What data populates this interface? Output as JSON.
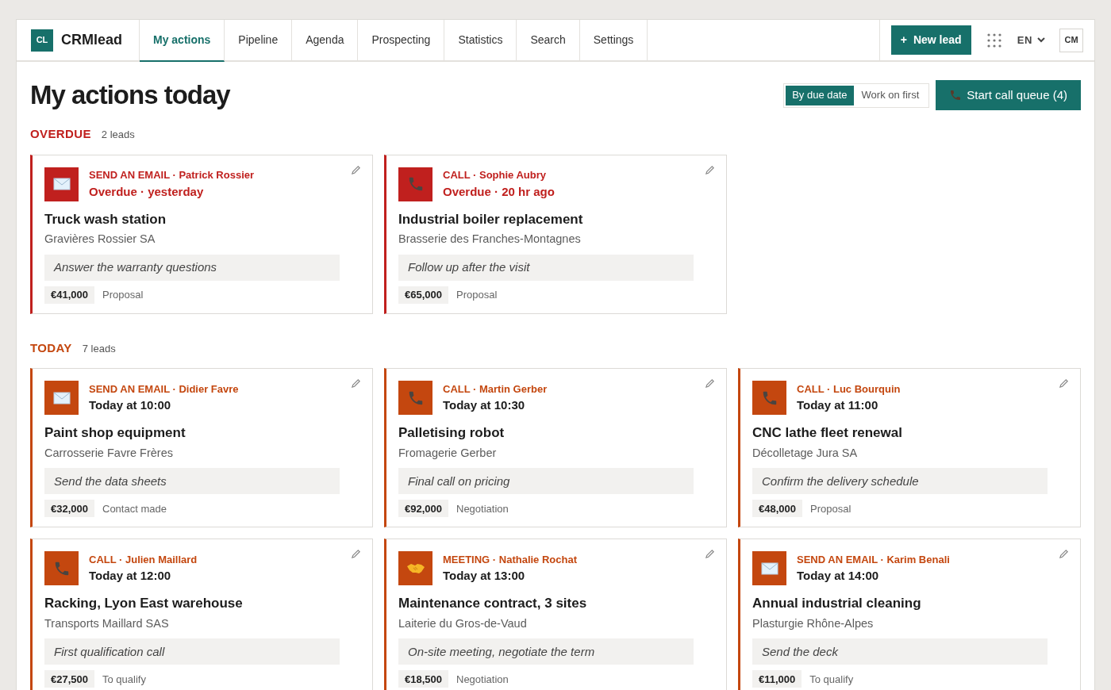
{
  "brand": {
    "badge": "CL",
    "name": "CRMlead"
  },
  "tabs": [
    {
      "label": "My actions",
      "selected": true
    },
    {
      "label": "Pipeline",
      "selected": false
    },
    {
      "label": "Agenda",
      "selected": false
    },
    {
      "label": "Prospecting",
      "selected": false
    },
    {
      "label": "Statistics",
      "selected": false
    },
    {
      "label": "Search",
      "selected": false
    },
    {
      "label": "Settings",
      "selected": false
    }
  ],
  "new_lead_button": {
    "icon": "+",
    "label": "New lead"
  },
  "language": "EN",
  "user_badge": "CM",
  "page_title": "My actions today",
  "sort_toggle": [
    {
      "label": "By due date",
      "selected": true
    },
    {
      "label": "Work on first",
      "selected": false
    }
  ],
  "call_queue_button": "Start call queue (4)",
  "sections": [
    {
      "kind": "overdue",
      "title": "OVERDUE",
      "count": "2 leads",
      "cards": [
        {
          "kind": "email",
          "action": "SEND AN EMAIL · Patrick Rossier",
          "due": "Overdue · yesterday",
          "title": "Truck wash station",
          "company": "Gravières Rossier SA",
          "note": "Answer the warranty questions",
          "amount": "€41,000",
          "stage": "Proposal"
        },
        {
          "kind": "call",
          "action": "CALL · Sophie Aubry",
          "due": "Overdue · 20 hr ago",
          "title": "Industrial boiler replacement",
          "company": "Brasserie des Franches-Montagnes",
          "note": "Follow up after the visit",
          "amount": "€65,000",
          "stage": "Proposal"
        }
      ]
    },
    {
      "kind": "today",
      "title": "TODAY",
      "count": "7 leads",
      "cards": [
        {
          "kind": "email",
          "action": "SEND AN EMAIL · Didier Favre",
          "due": "Today at 10:00",
          "title": "Paint shop equipment",
          "company": "Carrosserie Favre Frères",
          "note": "Send the data sheets",
          "amount": "€32,000",
          "stage": "Contact made"
        },
        {
          "kind": "call",
          "action": "CALL · Martin Gerber",
          "due": "Today at 10:30",
          "title": "Palletising robot",
          "company": "Fromagerie Gerber",
          "note": "Final call on pricing",
          "amount": "€92,000",
          "stage": "Negotiation"
        },
        {
          "kind": "call",
          "action": "CALL · Luc Bourquin",
          "due": "Today at 11:00",
          "title": "CNC lathe fleet renewal",
          "company": "Décolletage Jura SA",
          "note": "Confirm the delivery schedule",
          "amount": "€48,000",
          "stage": "Proposal"
        },
        {
          "kind": "call",
          "action": "CALL · Julien Maillard",
          "due": "Today at 12:00",
          "title": "Racking, Lyon East warehouse",
          "company": "Transports Maillard SAS",
          "note": "First qualification call",
          "amount": "€27,500",
          "stage": "To qualify"
        },
        {
          "kind": "meeting",
          "action": "MEETING · Nathalie Rochat",
          "due": "Today at 13:00",
          "title": "Maintenance contract, 3 sites",
          "company": "Laiterie du Gros-de-Vaud",
          "note": "On-site meeting, negotiate the term",
          "amount": "€18,500",
          "stage": "Negotiation"
        },
        {
          "kind": "email",
          "action": "SEND AN EMAIL · Karim Benali",
          "due": "Today at 14:00",
          "title": "Annual industrial cleaning",
          "company": "Plasturgie Rhône-Alpes",
          "note": "Send the deck",
          "amount": "€11,000",
          "stage": "To qualify"
        }
      ]
    }
  ]
}
